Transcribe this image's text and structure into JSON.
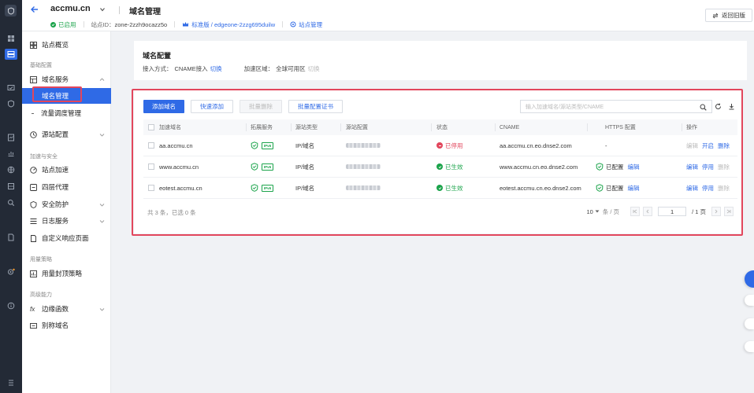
{
  "colors": {
    "accent": "#2f6ae6",
    "success": "#1aa34a",
    "danger": "#e2465c",
    "rail_bg": "#232a36"
  },
  "header": {
    "site_name": "accmu.cn",
    "page_title": "域名管理",
    "status": "已启用",
    "zone_label": "站点ID：",
    "zone_id": "zone-2zzh9ocazz5o",
    "plan": "标准版 / edgeone-2zzg695duilw",
    "site_manage": "站点管理",
    "back_old": "返回旧版"
  },
  "sidebar": {
    "overview": "站点概览",
    "group_basic": "基础配置",
    "domain_service": "域名服务",
    "domain_manage": "域名管理",
    "traffic": "流量调度管理",
    "origin": "源站配置",
    "group_accel": "加速与安全",
    "site_accel": "站点加速",
    "l4": "四层代理",
    "security": "安全防护",
    "logs": "日志服务",
    "custom_page": "自定义响应页面",
    "group_usage": "用量策略",
    "usage_cap": "用量封顶策略",
    "group_adv": "高级能力",
    "edge_func": "边缘函数",
    "alias": "别称域名"
  },
  "config": {
    "title": "域名配置",
    "access_label": "接入方式：",
    "access_value": "CNAME接入",
    "access_switch": "切换",
    "region_label": "加速区域：",
    "region_value": "全球可用区",
    "region_switch": "切换"
  },
  "toolbar": {
    "add": "添加域名",
    "quick_add": "快速添加",
    "batch_delete": "批量删除",
    "batch_cert": "批量配置证书",
    "search_placeholder": "输入加速域名/源站类型/CNAME"
  },
  "table": {
    "headers": [
      "加速域名",
      "拓展服务",
      "源站类型",
      "源站配置",
      "状态",
      "CNAME",
      "HTTPS 配置",
      "操作"
    ],
    "ipv6_badge": "IPv6",
    "rows": [
      {
        "domain": "aa.accmu.cn",
        "origin_type": "IP/域名",
        "status": "已停用",
        "status_kind": "stopped",
        "cname": "aa.accmu.cn.eo.dnse2.com",
        "https": "-",
        "https_edit": "",
        "op1": "编辑",
        "op2": "开启",
        "op3": "删除",
        "op1_on": false,
        "op2_on": true,
        "op3_on": true
      },
      {
        "domain": "www.accmu.cn",
        "origin_type": "IP/域名",
        "status": "已生效",
        "status_kind": "ok",
        "cname": "www.accmu.cn.eo.dnse2.com",
        "https": "已配置",
        "https_edit": "编辑",
        "op1": "编辑",
        "op2": "停用",
        "op3": "删除",
        "op1_on": true,
        "op2_on": true,
        "op3_on": false
      },
      {
        "domain": "eotest.accmu.cn",
        "origin_type": "IP/域名",
        "status": "已生效",
        "status_kind": "ok",
        "cname": "eotest.accmu.cn.eo.dnse2.com",
        "https": "已配置",
        "https_edit": "编辑",
        "op1": "编辑",
        "op2": "停用",
        "op3": "删除",
        "op1_on": true,
        "op2_on": true,
        "op3_on": false
      }
    ]
  },
  "footer": {
    "summary": "共 3 条，已选 0 条",
    "page_size": "10",
    "page_size_unit": "条 / 页",
    "current_page": "1",
    "total_pages": "/ 1 页"
  }
}
